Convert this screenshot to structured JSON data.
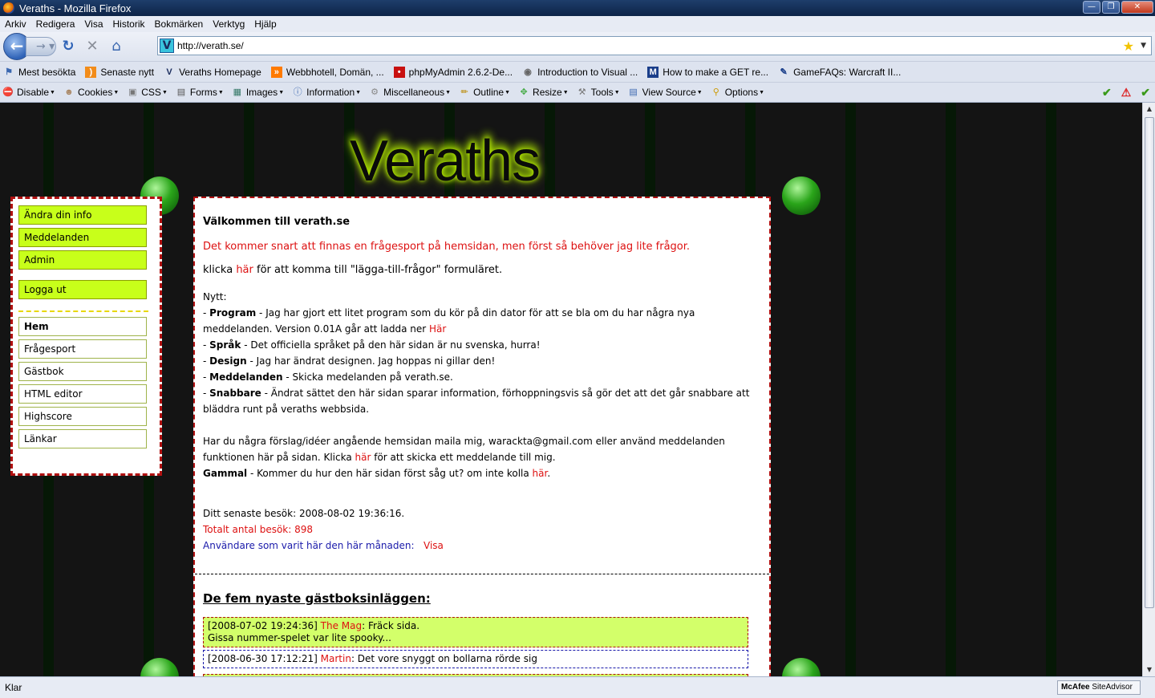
{
  "window": {
    "title": "Veraths - Mozilla Firefox"
  },
  "menubar": [
    "Arkiv",
    "Redigera",
    "Visa",
    "Historik",
    "Bokmärken",
    "Verktyg",
    "Hjälp"
  ],
  "navbar": {
    "url": "http://verath.se/"
  },
  "bookmarks": [
    {
      "label": "Mest besökta",
      "icon": "bookmark-icon"
    },
    {
      "label": "Senaste nytt",
      "icon": "rss-icon"
    },
    {
      "label": "Veraths Homepage",
      "icon": "v-logo-icon"
    },
    {
      "label": "Webbhotell, Domän, ...",
      "icon": "arrow-icon"
    },
    {
      "label": "phpMyAdmin 2.6.2-De...",
      "icon": "phpmyadmin-icon"
    },
    {
      "label": "Introduction to Visual ...",
      "icon": "visual-icon"
    },
    {
      "label": "How to make a GET re...",
      "icon": "m-logo-icon"
    },
    {
      "label": "GameFAQs: Warcraft II...",
      "icon": "gamefaqs-icon"
    }
  ],
  "devtools": [
    {
      "label": "Disable",
      "icon": "disable-icon"
    },
    {
      "label": "Cookies",
      "icon": "cookies-icon"
    },
    {
      "label": "CSS",
      "icon": "css-icon"
    },
    {
      "label": "Forms",
      "icon": "forms-icon"
    },
    {
      "label": "Images",
      "icon": "images-icon"
    },
    {
      "label": "Information",
      "icon": "info-icon"
    },
    {
      "label": "Miscellaneous",
      "icon": "misc-icon"
    },
    {
      "label": "Outline",
      "icon": "outline-icon"
    },
    {
      "label": "Resize",
      "icon": "resize-icon"
    },
    {
      "label": "Tools",
      "icon": "tools-icon"
    },
    {
      "label": "View Source",
      "icon": "view-source-icon"
    },
    {
      "label": "Options",
      "icon": "options-icon"
    }
  ],
  "page": {
    "logo": "Veraths",
    "sidebar": {
      "top": [
        "Ändra din info",
        "Meddelanden",
        "Admin"
      ],
      "logout": "Logga ut",
      "nav": [
        "Hem",
        "Frågesport",
        "Gästbok",
        "HTML editor",
        "Highscore",
        "Länkar"
      ]
    },
    "welcome": "Välkommen till verath.se",
    "intro_red": "Det kommer snart att finnas en frågesport på hemsidan, men först så behöver jag lite frågor.",
    "intro_prefix": "klicka ",
    "intro_link": "här",
    "intro_suffix": " för att komma till \"lägga-till-frågor\" formuläret.",
    "news": {
      "heading": "Nytt:",
      "program_label": "Program",
      "program_text": " - Jag har gjort ett litet program som du kör på din dator för att se bla om du har några nya meddelanden. Version 0.01A går att ladda ner ",
      "program_link": "Här",
      "sprak_label": "Språk",
      "sprak_text": " - Det officiella språket på den här sidan är nu svenska, hurra!",
      "design_label": "Design",
      "design_text": " - Jag har ändrat designen. Jag hoppas ni gillar den!",
      "med_label": "Meddelanden",
      "med_text": " - Skicka medelanden på verath.se.",
      "snabb_label": "Snabbare",
      "snabb_text": " - Ändrat sättet den här sidan sparar information, förhoppningsvis så gör det att det går snabbare att bläddra runt på veraths webbsida.",
      "contact_text": "Har du några förslag/idéer angående hemsidan maila mig, warackta@gmail.com eller använd meddelanden funktionen här på sidan. Klicka ",
      "contact_link": "här",
      "contact_suffix": " för att skicka ett meddelande till mig.",
      "gammal_label": "Gammal",
      "gammal_text": " - Kommer du hur den här sidan först såg ut? om inte kolla ",
      "gammal_link": "här",
      "gammal_end": "."
    },
    "stats": {
      "last_visit": "Ditt senaste besök: 2008-08-02 19:36:16.",
      "total": "Totalt antal besök: 898",
      "users_month": "Användare som varit här den här månaden:",
      "show": "Visa"
    },
    "guestbook": {
      "title": "De fem nyaste gästboksinläggen:",
      "entries": [
        {
          "time": "[2008-07-02 19:24:36]",
          "author": "The Mag",
          "text": ": Fräck sida.",
          "text2": "Gissa nummer-spelet var lite spooky..."
        },
        {
          "time": "[2008-06-30 17:12:21]",
          "author": "Martin",
          "text": ": Det vore snyggt on bollarna rörde sig",
          "text2": ""
        }
      ]
    }
  },
  "status": {
    "text": "Klar",
    "siteadvisor_brand": "McAfee",
    "siteadvisor_name": "SiteAdvisor"
  }
}
